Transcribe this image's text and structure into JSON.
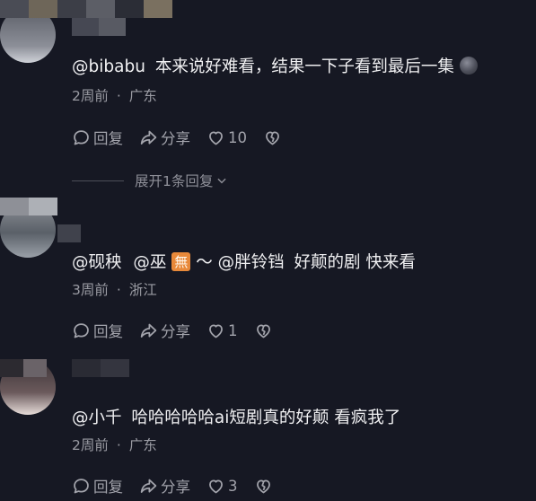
{
  "comments": [
    {
      "username": "@bibabu",
      "text": "本来说好难看，结果一下子看到最后一集",
      "time": "2周前",
      "separator": "·",
      "location": "广东",
      "reply_label": "回复",
      "share_label": "分享",
      "likes": "10"
    },
    {
      "mention1": "@砚秧",
      "mention2": "@巫",
      "emoji_badge": "無",
      "tilde": "～",
      "mention3": "@胖铃铛",
      "text": "好颠的剧 快来看",
      "time": "3周前",
      "separator": "·",
      "location": "浙江",
      "reply_label": "回复",
      "share_label": "分享",
      "likes": "1"
    },
    {
      "username": "@小千",
      "text": "哈哈哈哈哈ai短剧真的好颠 看疯我了",
      "time": "2周前",
      "separator": "·",
      "location": "广东",
      "reply_label": "回复",
      "share_label": "分享",
      "likes": "3"
    }
  ],
  "expand_replies": {
    "label": "展开1条回复"
  },
  "colors": {
    "background": "#161823",
    "text": "#f0f0f2",
    "meta": "#9a9ba3",
    "emoji_badge": "#e8893a"
  }
}
